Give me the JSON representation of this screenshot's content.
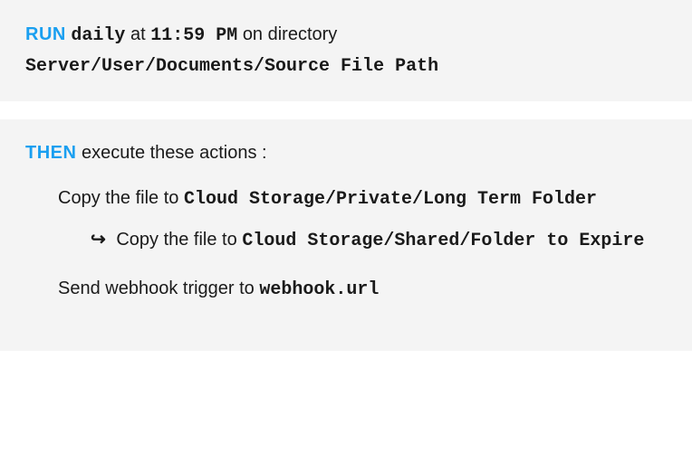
{
  "run": {
    "keyword": "RUN",
    "frequency": "daily",
    "at_word": "at",
    "time": "11:59 PM",
    "on_word": "on directory",
    "path": "Server/User/Documents/Source File Path"
  },
  "then": {
    "keyword": "THEN",
    "intro": "execute these actions :"
  },
  "actions": [
    {
      "prefix": "Copy the file to",
      "path": "Cloud Storage/Private/Long Term Folder",
      "sub": {
        "prefix": "Copy the file to",
        "path": "Cloud Storage/Shared/Folder to Expire"
      }
    },
    {
      "prefix": "Send webhook trigger to",
      "path": "webhook.url"
    }
  ]
}
